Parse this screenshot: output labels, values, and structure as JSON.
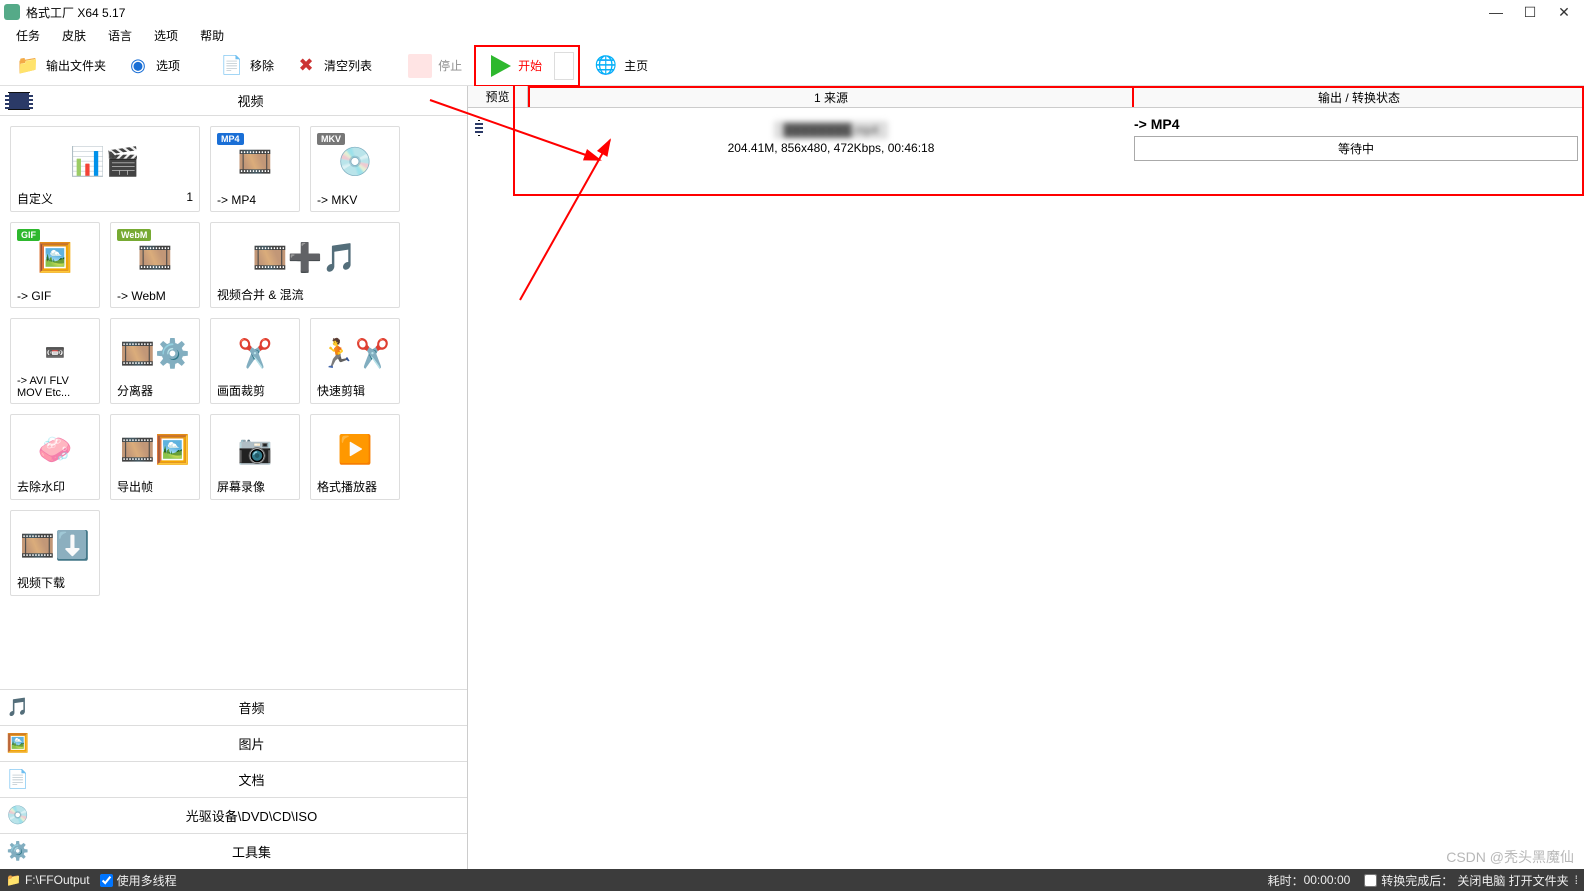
{
  "window": {
    "title": "格式工厂 X64 5.17"
  },
  "menu": {
    "task": "任务",
    "skin": "皮肤",
    "lang": "语言",
    "option": "选项",
    "help": "帮助"
  },
  "toolbar": {
    "output_folder": "输出文件夹",
    "option": "选项",
    "remove": "移除",
    "clear_list": "清空列表",
    "stop": "停止",
    "start": "开始",
    "home": "主页"
  },
  "left_panel": {
    "video_header": "视频"
  },
  "tools": {
    "custom": "自定义",
    "custom_count": "1",
    "mp4": "-> MP4",
    "mkv": "-> MKV",
    "gif": "-> GIF",
    "webm": "-> WebM",
    "merge": "视频合并 & 混流",
    "avi": "-> AVI FLV MOV Etc...",
    "splitter": "分离器",
    "crop": "画面裁剪",
    "quick": "快速剪辑",
    "watermark": "去除水印",
    "export_frame": "导出帧",
    "record": "屏幕录像",
    "player": "格式播放器",
    "download": "视频下载"
  },
  "categories": {
    "audio": "音频",
    "image": "图片",
    "doc": "文档",
    "disc": "光驱设备\\DVD\\CD\\ISO",
    "toolset": "工具集"
  },
  "table": {
    "col_preview": "预览",
    "col_source": "1 来源",
    "col_status": "输出 / 转换状态",
    "row_name": "████████.mp4",
    "row_info": "204.41M, 856x480, 472Kbps, 00:46:18",
    "row_out": "-> MP4",
    "row_state": "等待中"
  },
  "statusbar": {
    "path": "F:\\FFOutput",
    "multithread": "使用多线程",
    "elapsed_label": "耗时：",
    "elapsed": "00:00:00",
    "after_label": "转换完成后：",
    "after_value": "关闭电脑 打开文件夹"
  },
  "watermark": "CSDN @秃头黑魔仙"
}
